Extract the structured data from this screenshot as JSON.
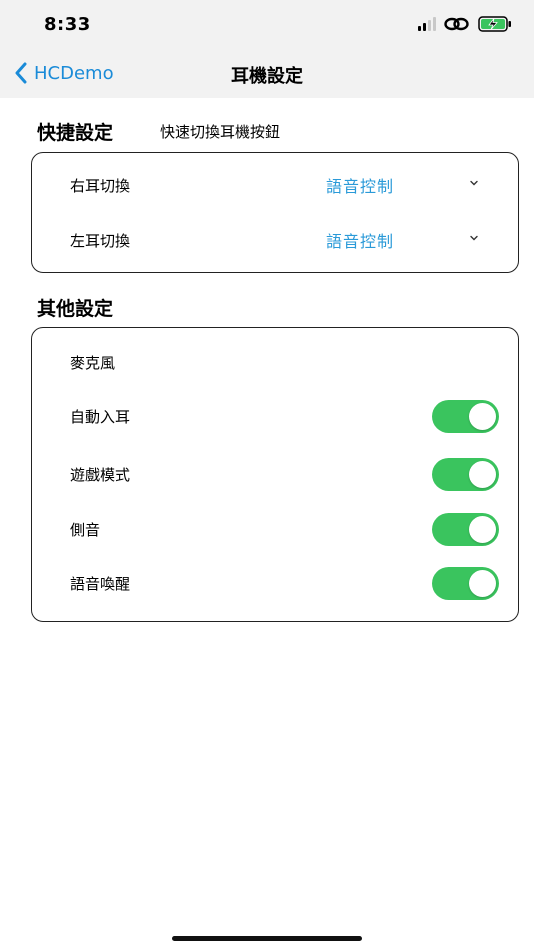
{
  "status_bar": {
    "time": "8:33",
    "signal_bars_active": 2,
    "signal_bars_total": 4,
    "battery": "charging"
  },
  "nav": {
    "back_label": "HCDemo",
    "title": "耳機設定"
  },
  "quick_settings": {
    "title": "快捷設定",
    "subtitle": "快速切換耳機按鈕",
    "rows": [
      {
        "label": "右耳切換",
        "value": "語音控制"
      },
      {
        "label": "左耳切換",
        "value": "語音控制"
      }
    ]
  },
  "other_settings": {
    "title": "其他設定",
    "rows": [
      {
        "label": "麥克風"
      },
      {
        "label": "自動入耳",
        "toggle": true
      },
      {
        "label": "遊戲模式",
        "toggle": true
      },
      {
        "label": "側音",
        "toggle": true
      },
      {
        "label": "語音喚醒",
        "toggle": true
      }
    ]
  },
  "colors": {
    "accent": "#1a8bd8",
    "value_text": "#2a9ad8",
    "toggle_on": "#3ac45e",
    "top_bg": "#f2f2f2"
  }
}
